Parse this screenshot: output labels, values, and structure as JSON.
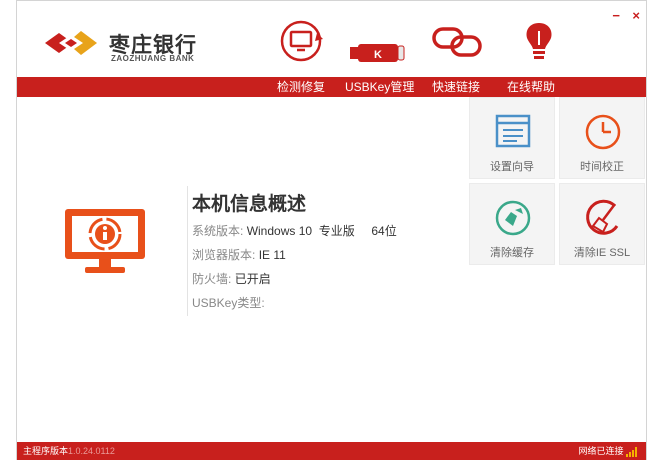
{
  "app": {
    "bank_name_cn": "枣庄银行",
    "bank_name_en": "ZAOZHUANG BANK"
  },
  "window_controls": {
    "minimize": "−",
    "close": "×"
  },
  "menu": [
    "检测修复",
    "USBKey管理",
    "快速链接",
    "在线帮助"
  ],
  "toolbar_icons": [
    "monitor-refresh-icon",
    "usb-key-icon",
    "link-icon",
    "lightbulb-icon"
  ],
  "usbkey_letter": "K",
  "info": {
    "title": "本机信息概述",
    "system_label": "系统版本:",
    "system_value": "Windows 10  专业版     64位",
    "browser_label": "浏览器版本:",
    "browser_value": "IE 11",
    "firewall_label": "防火墙:",
    "firewall_value": "已开启",
    "usbkey_label": "USBKey类型:",
    "usbkey_value": ""
  },
  "tiles": [
    {
      "label": "设置向导",
      "icon": "setup-wizard-icon"
    },
    {
      "label": "时间校正",
      "icon": "clock-icon"
    },
    {
      "label": "清除缓存",
      "icon": "clear-cache-icon"
    },
    {
      "label": "清除IE SSL",
      "icon": "broom-icon"
    }
  ],
  "status": {
    "version_label": "主程序版本",
    "version_value": "1.0.24.0112",
    "network": "网络已连接"
  },
  "colors": {
    "brand_red": "#c8201d",
    "accent_orange": "#e8501a"
  }
}
